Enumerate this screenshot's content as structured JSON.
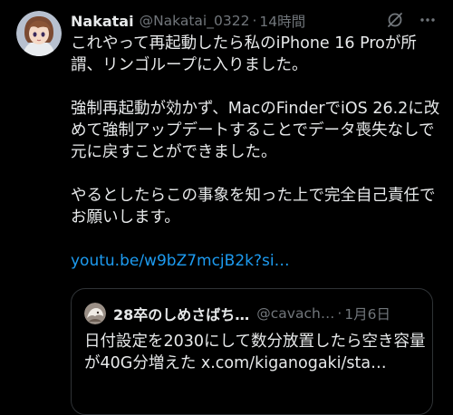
{
  "post": {
    "display_name": "Nakatai",
    "handle": "@Nakatai_0322",
    "separator": "·",
    "time": "14時間",
    "paragraphs": [
      "これやって再起動したら私のiPhone 16 Proが所謂、リンゴループに入りました。",
      "強制再起動が効かず、MacのFinderでiOS 26.2に改めて強制アップデートすることでデータ喪失なしで元に戻すことができました。",
      "やるとしたらこの事象を知った上で完全自己責任でお願いします。"
    ],
    "link": "youtu.be/w9bZ7mcjB2k?si…",
    "icons": {
      "grok": "grok-icon",
      "more": "more-icon"
    }
  },
  "quote": {
    "display_name": "28卒のしめさばち…",
    "handle": "@cavach…",
    "separator": "·",
    "time": "1月6日",
    "text": "日付設定を2030にして数分放置したら空き容量が40G分増えた x.com/kiganogaki/sta…"
  },
  "colors": {
    "background": "#000000",
    "text": "#e7e9ea",
    "muted": "#71767b",
    "link": "#1d9bf0",
    "border": "#2f3336"
  }
}
